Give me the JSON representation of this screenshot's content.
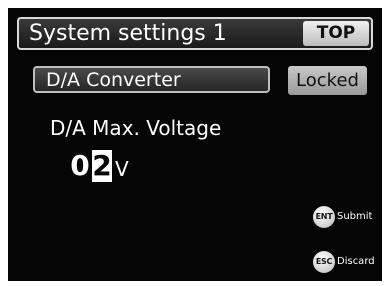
{
  "header": {
    "title": "System settings 1",
    "top_button": "TOP"
  },
  "menu": {
    "selected_item": "D/A Converter",
    "status_badge": "Locked"
  },
  "setting": {
    "label": "D/A Max. Voltage",
    "digits": [
      "0",
      "2"
    ],
    "cursor_digit_index": 1,
    "unit": "V"
  },
  "key_hints": {
    "submit": {
      "key": "ENT",
      "label": "Submit"
    },
    "discard": {
      "key": "ESC",
      "label": "Discard"
    }
  },
  "colors": {
    "screen_background": "#050505",
    "text": "#ffffff",
    "button_face": "#d8d8d8"
  },
  "icons": {
    "enter_key": "enter-key-icon",
    "escape_key": "escape-key-icon"
  }
}
